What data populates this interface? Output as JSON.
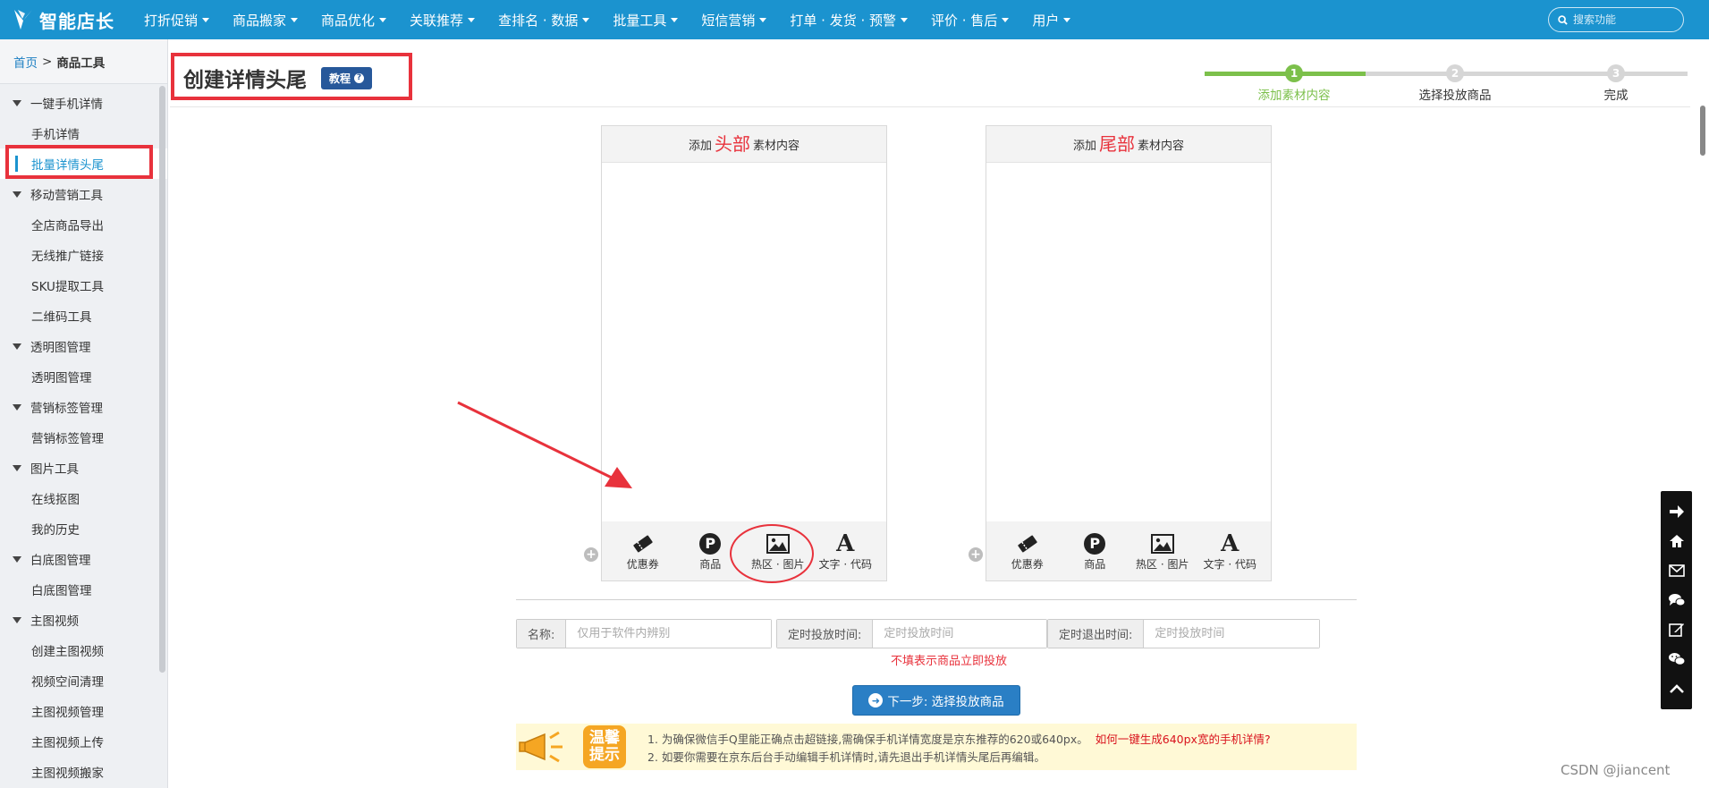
{
  "brand": {
    "name": "智能店长"
  },
  "nav": {
    "items": [
      {
        "label": "打折促销",
        "caret": true
      },
      {
        "label": "商品搬家",
        "caret": true
      },
      {
        "label": "商品优化",
        "caret": true
      },
      {
        "label": "关联推荐",
        "caret": true
      },
      {
        "label": "查排名 · 数据",
        "caret": true
      },
      {
        "label": "批量工具",
        "caret": true
      },
      {
        "label": "短信营销",
        "caret": true
      },
      {
        "label": "打单 · 发货 · 预警",
        "caret": true
      },
      {
        "label": "评价 · 售后",
        "caret": true
      },
      {
        "label": "用户",
        "caret": true
      }
    ],
    "search_placeholder": "搜索功能"
  },
  "breadcrumb": {
    "home": "首页",
    "separator": ">",
    "current": "商品工具"
  },
  "sidebar": {
    "menu": [
      {
        "type": "group",
        "label": "一键手机详情"
      },
      {
        "type": "item",
        "label": "手机详情"
      },
      {
        "type": "item",
        "label": "批量详情头尾",
        "active": true
      },
      {
        "type": "group",
        "label": "移动营销工具"
      },
      {
        "type": "item",
        "label": "全店商品导出"
      },
      {
        "type": "item",
        "label": "无线推广链接"
      },
      {
        "type": "item",
        "label": "SKU提取工具"
      },
      {
        "type": "item",
        "label": "二维码工具"
      },
      {
        "type": "group",
        "label": "透明图管理"
      },
      {
        "type": "item",
        "label": "透明图管理"
      },
      {
        "type": "group",
        "label": "营销标签管理"
      },
      {
        "type": "item",
        "label": "营销标签管理"
      },
      {
        "type": "group",
        "label": "图片工具"
      },
      {
        "type": "item",
        "label": "在线抠图"
      },
      {
        "type": "item",
        "label": "我的历史"
      },
      {
        "type": "group",
        "label": "白底图管理"
      },
      {
        "type": "item",
        "label": "白底图管理"
      },
      {
        "type": "group",
        "label": "主图视频"
      },
      {
        "type": "item",
        "label": "创建主图视频"
      },
      {
        "type": "item",
        "label": "视频空间清理"
      },
      {
        "type": "item",
        "label": "主图视频管理"
      },
      {
        "type": "item",
        "label": "主图视频上传"
      },
      {
        "type": "item",
        "label": "主图视频搬家"
      }
    ]
  },
  "page": {
    "title": "创建详情头尾",
    "tutorial_label": "教程",
    "tutorial_icon": "?"
  },
  "steps": [
    {
      "num": "1",
      "label": "添加素材内容",
      "state": "active"
    },
    {
      "num": "2",
      "label": "选择投放商品",
      "state": "pending"
    },
    {
      "num": "3",
      "label": "完成",
      "state": "pending"
    }
  ],
  "panels": {
    "head": {
      "prefix": "添加",
      "highlight": "头部",
      "suffix": "素材内容"
    },
    "tail": {
      "prefix": "添加",
      "highlight": "尾部",
      "suffix": "素材内容"
    },
    "tools": [
      {
        "label": "优惠券",
        "icon": "coupon-icon"
      },
      {
        "label": "商品",
        "icon": "product-p-icon"
      },
      {
        "label": "热区 · 图片",
        "icon": "image-icon"
      },
      {
        "label": "文字 · 代码",
        "icon": "text-a-icon"
      }
    ],
    "add_symbol": "+"
  },
  "form": {
    "name_label": "名称:",
    "name_placeholder": "仅用于软件内辨别",
    "start_label": "定时投放时间:",
    "start_placeholder": "定时投放时间",
    "end_label": "定时退出时间:",
    "end_placeholder": "定时投放时间",
    "hint": "不填表示商品立即投放"
  },
  "next_button": {
    "label": "下一步: 选择投放商品"
  },
  "tips": {
    "badge_top": "温馨",
    "badge_bottom": "提示",
    "line1": "1. 为确保微信手Q里能正确点击超链接,需确保手机详情宽度是京东推荐的620或640px。",
    "line1_link": "如何一键生成640px宽的手机详情?",
    "line2": "2. 如要你需要在京东后台手动编辑手机详情时,请先退出手机详情头尾后再编辑。"
  },
  "right_toolbar": [
    "arrow-right-icon",
    "home-icon",
    "mail-icon",
    "chat-icon",
    "edit-icon",
    "wechat-icon",
    "up-icon"
  ],
  "watermark": "CSDN @jiancent",
  "colors": {
    "nav": "#1b93cf",
    "accent_red": "#e8323c",
    "step_green": "#7cc04b",
    "primary_btn": "#2a7fc5"
  }
}
